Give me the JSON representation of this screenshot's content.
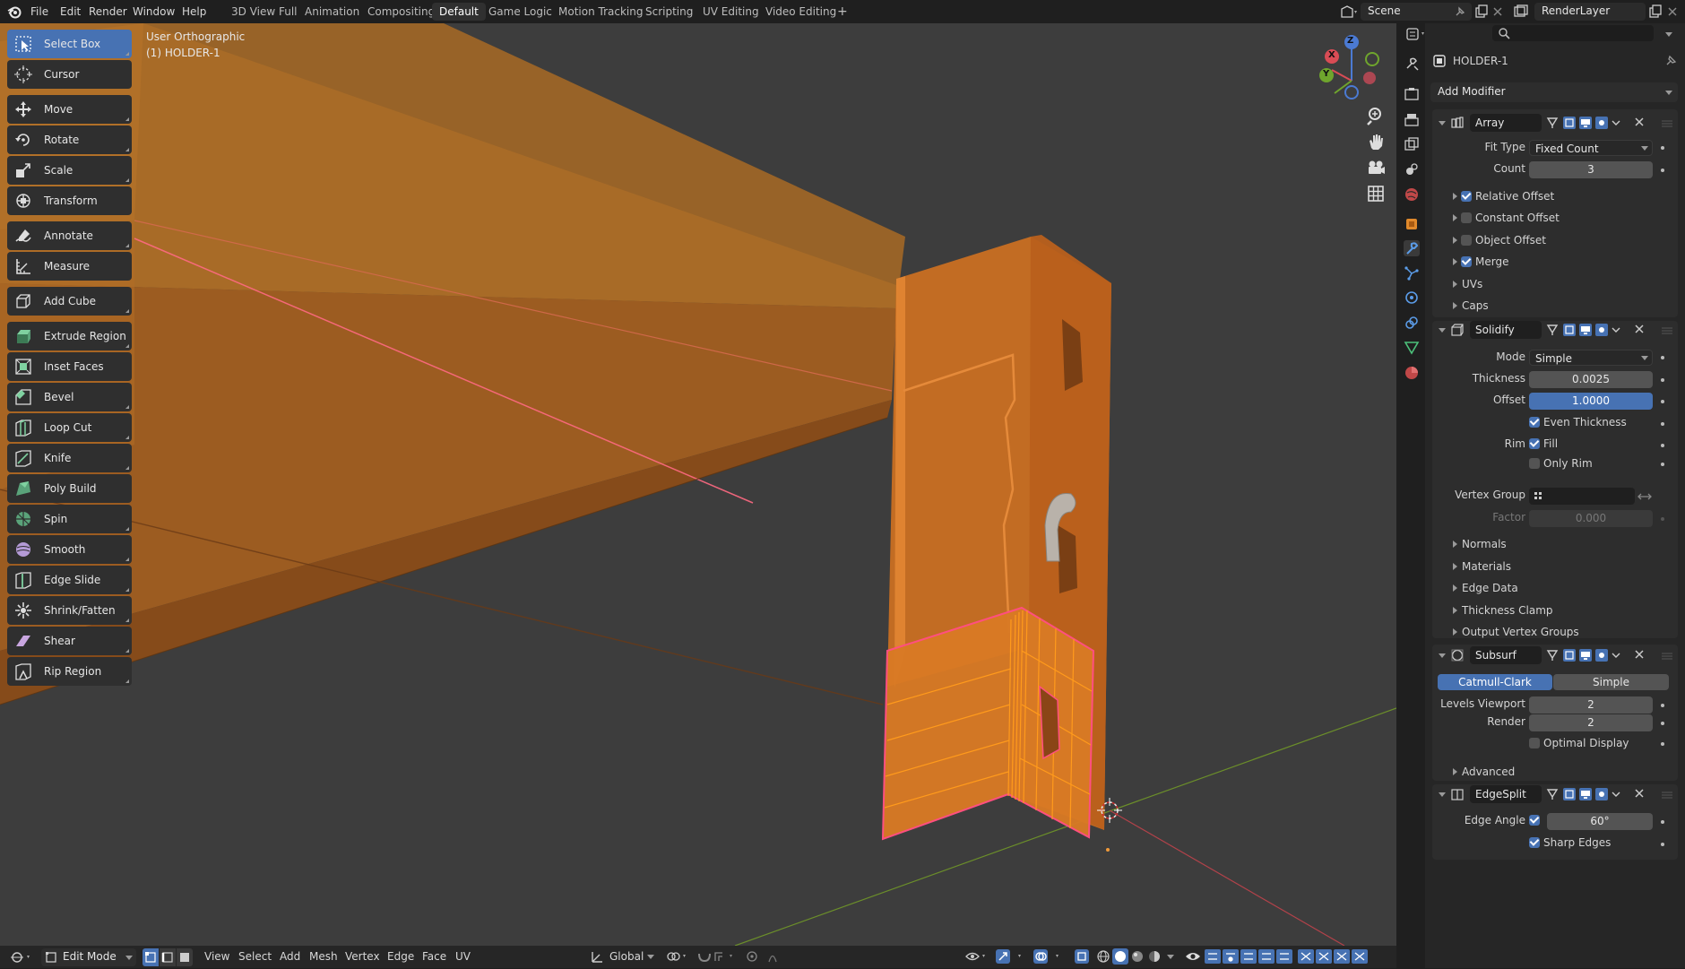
{
  "menubar": {
    "items": [
      "File",
      "Edit",
      "Render",
      "Window",
      "Help"
    ]
  },
  "workspaces": [
    "3D View Full",
    "Animation",
    "Compositing",
    "Default",
    "Game Logic",
    "Motion Tracking",
    "Scripting",
    "UV Editing",
    "Video Editing"
  ],
  "workspace_add": "+",
  "scene": {
    "name": "Scene"
  },
  "view_layer": {
    "name": "RenderLayer"
  },
  "viewport": {
    "view_name": "User Orthographic",
    "object_label": "(1) HOLDER-1"
  },
  "gizmo": {
    "x": "X",
    "y": "Y",
    "z": "Z"
  },
  "toolbar": {
    "tools": [
      "Select Box",
      "Cursor",
      "Move",
      "Rotate",
      "Scale",
      "Transform",
      "Annotate",
      "Measure",
      "Add Cube",
      "Extrude Region",
      "Inset Faces",
      "Bevel",
      "Loop Cut",
      "Knife",
      "Poly Build",
      "Spin",
      "Smooth",
      "Edge Slide",
      "Shrink/Fatten",
      "Shear",
      "Rip Region"
    ],
    "selected": "Select Box"
  },
  "header": {
    "mode": "Edit Mode",
    "menus": [
      "View",
      "Select",
      "Add",
      "Mesh",
      "Vertex",
      "Edge",
      "Face",
      "UV"
    ],
    "orientation": "Global"
  },
  "properties": {
    "object_name": "HOLDER-1",
    "add_modifier": "Add Modifier",
    "array": {
      "name": "Array",
      "fit_type_label": "Fit Type",
      "fit_type": "Fixed Count",
      "count_label": "Count",
      "count": "3",
      "subs": [
        {
          "label": "Relative Offset",
          "checked": true
        },
        {
          "label": "Constant Offset",
          "checked": false
        },
        {
          "label": "Object Offset",
          "checked": false
        },
        {
          "label": "Merge",
          "checked": true
        },
        {
          "label": "UVs"
        },
        {
          "label": "Caps"
        }
      ]
    },
    "solidify": {
      "name": "Solidify",
      "mode_label": "Mode",
      "mode": "Simple",
      "thickness_label": "Thickness",
      "thickness": "0.0025",
      "offset_label": "Offset",
      "offset": "1.0000",
      "even_thickness": "Even Thickness",
      "rim_label": "Rim",
      "fill": "Fill",
      "only_rim": "Only Rim",
      "vertex_group_label": "Vertex Group",
      "factor_label": "Factor",
      "factor": "0.000",
      "subs": [
        "Normals",
        "Materials",
        "Edge Data",
        "Thickness Clamp",
        "Output Vertex Groups"
      ]
    },
    "subsurf": {
      "name": "Subsurf",
      "catmull": "Catmull-Clark",
      "simple": "Simple",
      "levels_label": "Levels Viewport",
      "levels": "2",
      "render_label": "Render",
      "render": "2",
      "optimal": "Optimal Display",
      "advanced": "Advanced"
    },
    "edgesplit": {
      "name": "EdgeSplit",
      "edge_angle_label": "Edge Angle",
      "edge_angle": "60°",
      "sharp_edges": "Sharp Edges"
    }
  },
  "colors": {
    "accent": "#4772b3",
    "orange": "#e07a1f",
    "selected_edge": "#ff5a8a"
  }
}
